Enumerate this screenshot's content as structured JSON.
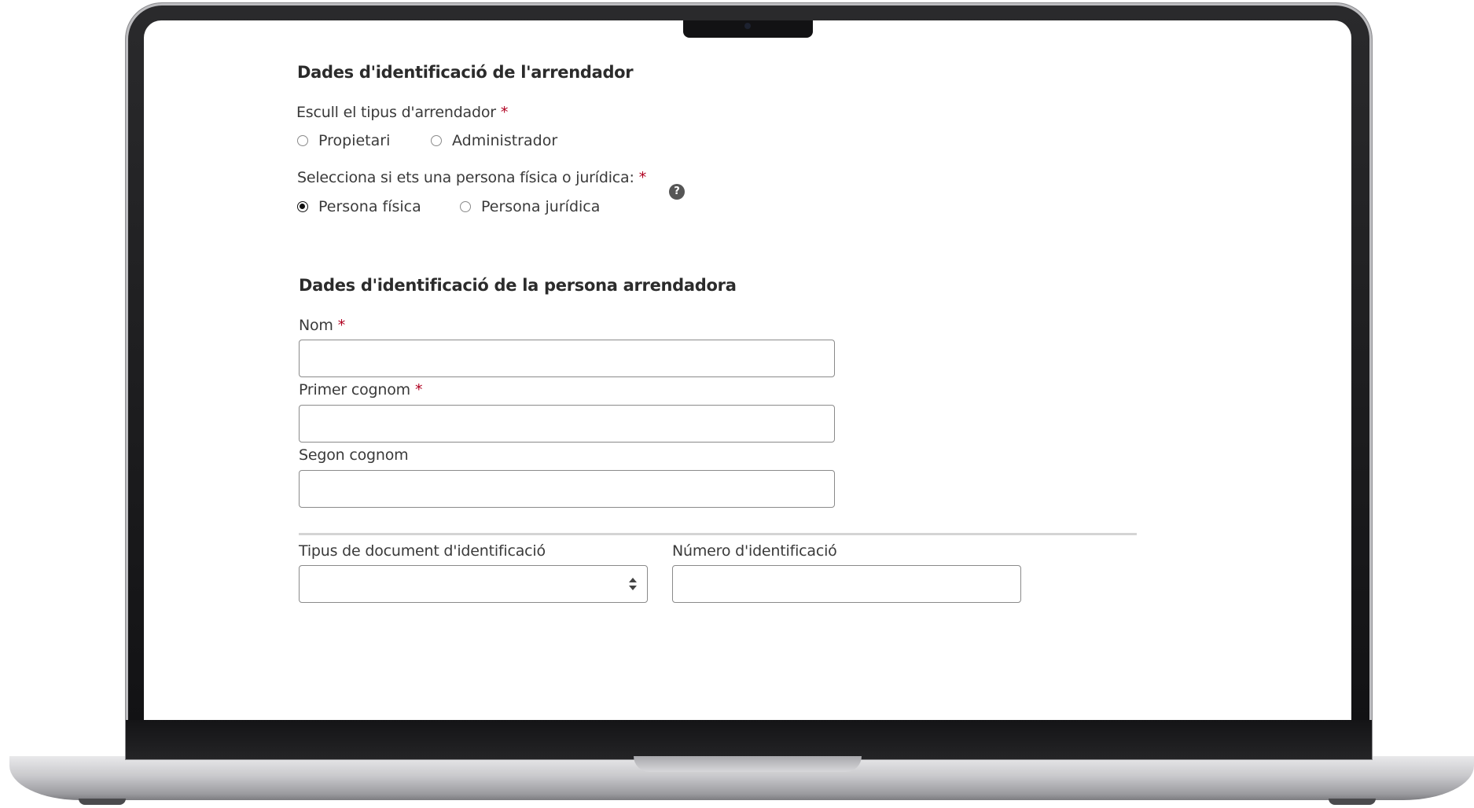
{
  "section_landlord": {
    "title": "Dades d'identificació de l'arrendador",
    "type_question": {
      "label": "Escull el tipus d'arrendador",
      "required_mark": "*",
      "options": [
        {
          "label": "Propietari",
          "checked": false
        },
        {
          "label": "Administrador",
          "checked": false
        }
      ]
    },
    "person_question": {
      "label": "Selecciona si ets una persona física o jurídica:",
      "required_mark": "*",
      "help_glyph": "?",
      "options": [
        {
          "label": "Persona física",
          "checked": true
        },
        {
          "label": "Persona jurídica",
          "checked": false
        }
      ]
    }
  },
  "section_person": {
    "title": "Dades d'identificació de la persona arrendadora",
    "fields": {
      "nom": {
        "label": "Nom",
        "required_mark": "*",
        "value": ""
      },
      "primer_cognom": {
        "label": "Primer cognom",
        "required_mark": "*",
        "value": ""
      },
      "segon_cognom": {
        "label": "Segon cognom",
        "value": ""
      }
    },
    "document_type": {
      "label": "Tipus de document d'identificació",
      "selected": ""
    },
    "document_number": {
      "label": "Número d'identificació",
      "value": ""
    }
  }
}
